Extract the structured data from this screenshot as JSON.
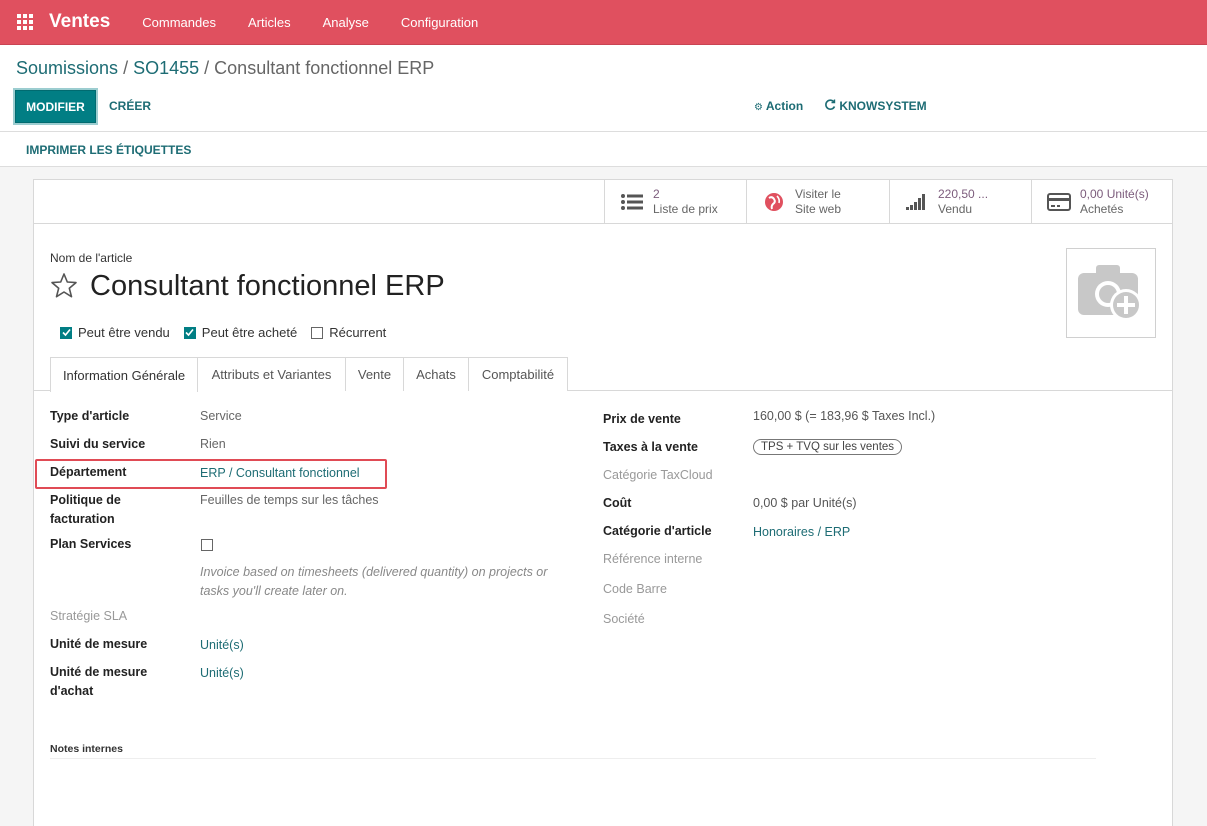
{
  "navbar": {
    "brand": "Ventes",
    "items": [
      "Commandes",
      "Articles",
      "Analyse",
      "Configuration"
    ]
  },
  "breadcrumb": {
    "parts": [
      "Soumissions",
      "SO1455",
      "Consultant fonctionnel ERP"
    ]
  },
  "buttons": {
    "modifier": "MODIFIER",
    "creer": "CRÉER",
    "action": "Action",
    "knowsystem": "KNOWSYSTEM",
    "print_labels": "IMPRIMER LES ÉTIQUETTES"
  },
  "smart_buttons": [
    {
      "line1": "2",
      "line2": "Liste de prix",
      "icon": "list-icon"
    },
    {
      "line1": "Visiter le",
      "line2": "Site web",
      "icon": "globe-icon"
    },
    {
      "line1": "220,50 ...",
      "line2": "Vendu",
      "icon": "signal-icon"
    },
    {
      "line1": "0,00 Unité(s)",
      "line2": "Achetés",
      "icon": "credit-card-icon"
    }
  ],
  "product": {
    "name_label": "Nom de l'article",
    "name": "Consultant fonctionnel ERP",
    "checkboxes": [
      {
        "label": "Peut être vendu",
        "checked": true
      },
      {
        "label": "Peut être acheté",
        "checked": true
      },
      {
        "label": "Récurrent",
        "checked": false
      }
    ]
  },
  "tabs": [
    "Information Générale",
    "Attributs et Variantes",
    "Vente",
    "Achats",
    "Comptabilité"
  ],
  "left_fields": {
    "type_label": "Type d'article",
    "type_value": "Service",
    "suivi_label": "Suivi du service",
    "suivi_value": "Rien",
    "dept_label": "Département",
    "dept_value": "ERP / Consultant fonctionnel",
    "politique_label_1": "Politique de",
    "politique_label_2": "facturation",
    "politique_value": "Feuilles de temps sur les tâches",
    "plan_label": "Plan Services",
    "plan_hint_1": "Invoice based on timesheets (delivered quantity) on projects or",
    "plan_hint_2": "tasks you'll create later on.",
    "sla_label": "Stratégie SLA",
    "uom_label": "Unité de mesure",
    "uom_value": "Unité(s)",
    "uom_po_label_1": "Unité de mesure",
    "uom_po_label_2": "d'achat",
    "uom_po_value": "Unité(s)"
  },
  "right_fields": {
    "prix_label": "Prix de vente",
    "prix_value": "160,00 $",
    "prix_incl": "(= 183,96 $ Taxes Incl.)",
    "taxes_label": "Taxes à la vente",
    "taxes_tag": "TPS + TVQ sur les ventes",
    "taxcloud_label": "Catégorie TaxCloud",
    "cout_label": "Coût",
    "cout_value": "0,00 $",
    "cout_unit": "par Unité(s)",
    "categ_label": "Catégorie d'article",
    "categ_value": "Honoraires / ERP",
    "ref_label": "Référence interne",
    "barcode_label": "Code Barre",
    "societe_label": "Société"
  },
  "notes_label": "Notes internes",
  "colors": {
    "navbar": "#e0505f",
    "primary": "#017e84",
    "link": "#1d6c74",
    "highlight": "#e04b55"
  }
}
